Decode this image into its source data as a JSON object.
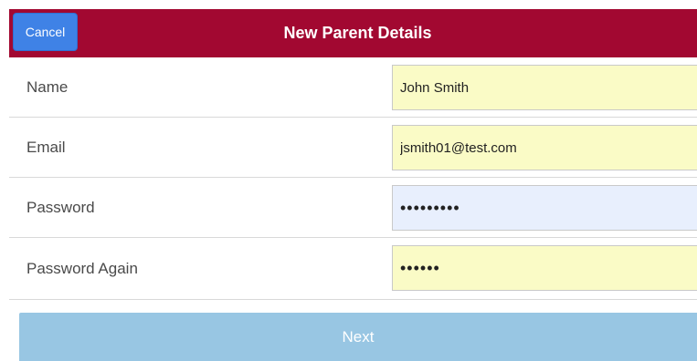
{
  "header": {
    "title": "New Parent Details",
    "cancel_label": "Cancel"
  },
  "form": {
    "fields": [
      {
        "label": "Name",
        "value": "John Smith"
      },
      {
        "label": "Email",
        "value": "jsmith01@test.com"
      },
      {
        "label": "Password",
        "value": "•••••••••"
      },
      {
        "label": "Password Again",
        "value": "••••••"
      }
    ]
  },
  "footer": {
    "next_label": "Next"
  },
  "colors": {
    "header_bg": "#a20831",
    "cancel_bg": "#3f82e6",
    "autofill_yellow": "#fafbc6",
    "autofill_blue": "#e8effd",
    "next_bg": "#98c6e3"
  }
}
